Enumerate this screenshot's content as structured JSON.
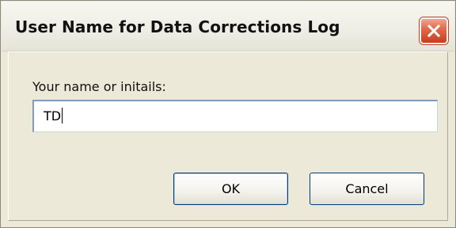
{
  "dialog": {
    "title": "User Name for Data Corrections Log",
    "close_icon": "close-icon"
  },
  "form": {
    "label": "Your name or initails:",
    "value": "TD"
  },
  "buttons": {
    "ok_label": "OK",
    "cancel_label": "Cancel"
  },
  "colors": {
    "dialog_bg": "#ece9d8",
    "close_button_red": "#e26b4c",
    "input_border": "#7f9db9",
    "button_border": "#003c74"
  }
}
